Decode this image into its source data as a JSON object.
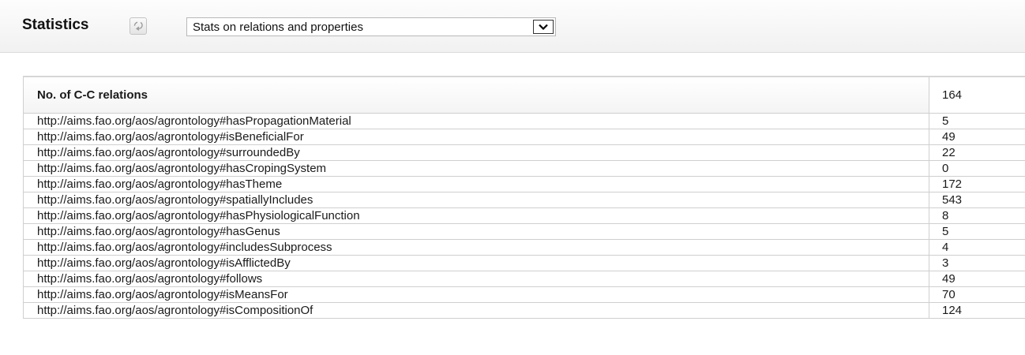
{
  "header": {
    "title": "Statistics",
    "select_value": "Stats on relations and properties"
  },
  "table": {
    "header_label": "No. of C-C relations",
    "header_value": "164",
    "rows": [
      {
        "label": "http://aims.fao.org/aos/agrontology#hasPropagationMaterial",
        "value": "5"
      },
      {
        "label": "http://aims.fao.org/aos/agrontology#isBeneficialFor",
        "value": "49"
      },
      {
        "label": "http://aims.fao.org/aos/agrontology#surroundedBy",
        "value": "22"
      },
      {
        "label": "http://aims.fao.org/aos/agrontology#hasCropingSystem",
        "value": "0"
      },
      {
        "label": "http://aims.fao.org/aos/agrontology#hasTheme",
        "value": "172"
      },
      {
        "label": "http://aims.fao.org/aos/agrontology#spatiallyIncludes",
        "value": "543"
      },
      {
        "label": "http://aims.fao.org/aos/agrontology#hasPhysiologicalFunction",
        "value": "8"
      },
      {
        "label": "http://aims.fao.org/aos/agrontology#hasGenus",
        "value": "5"
      },
      {
        "label": "http://aims.fao.org/aos/agrontology#includesSubprocess",
        "value": "4"
      },
      {
        "label": "http://aims.fao.org/aos/agrontology#isAfflictedBy",
        "value": "3"
      },
      {
        "label": "http://aims.fao.org/aos/agrontology#follows",
        "value": "49"
      },
      {
        "label": "http://aims.fao.org/aos/agrontology#isMeansFor",
        "value": "70"
      },
      {
        "label": "http://aims.fao.org/aos/agrontology#isCompositionOf",
        "value": "124"
      }
    ]
  },
  "icons": {
    "refresh": "refresh-icon",
    "dropdown": "chevron-down-icon"
  }
}
